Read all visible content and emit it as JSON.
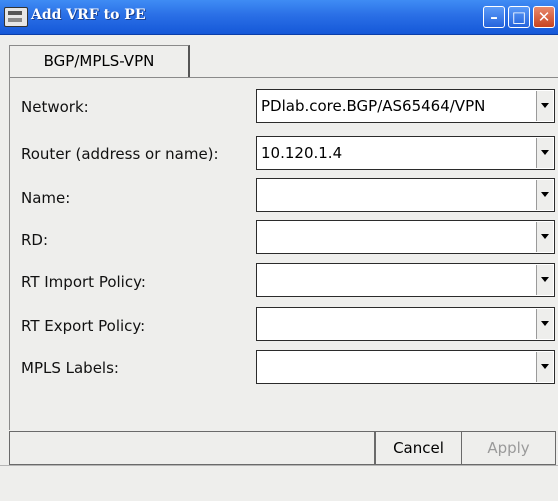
{
  "window": {
    "title": "Add VRF to PE",
    "minimize_icon": "minimize-icon",
    "maximize_icon": "maximize-icon",
    "close_icon": "close-icon"
  },
  "tabs": [
    {
      "label": "BGP/MPLS-VPN",
      "selected": true
    }
  ],
  "form": {
    "fields": [
      {
        "label": "Network:",
        "value": "PDlab.core.BGP/AS65464/VPN"
      },
      {
        "label": "Router (address or name):",
        "value": "10.120.1.4"
      },
      {
        "label": "Name:",
        "value": ""
      },
      {
        "label": "RD:",
        "value": ""
      },
      {
        "label": "RT Import Policy:",
        "value": ""
      },
      {
        "label": "RT Export Policy:",
        "value": ""
      },
      {
        "label": "MPLS Labels:",
        "value": ""
      }
    ]
  },
  "buttons": {
    "cancel": "Cancel",
    "apply": "Apply",
    "apply_enabled": false
  },
  "colors": {
    "titlebar": "#2a6fe6",
    "background": "#eeeeec",
    "disabled_text": "#9a9a9a"
  }
}
